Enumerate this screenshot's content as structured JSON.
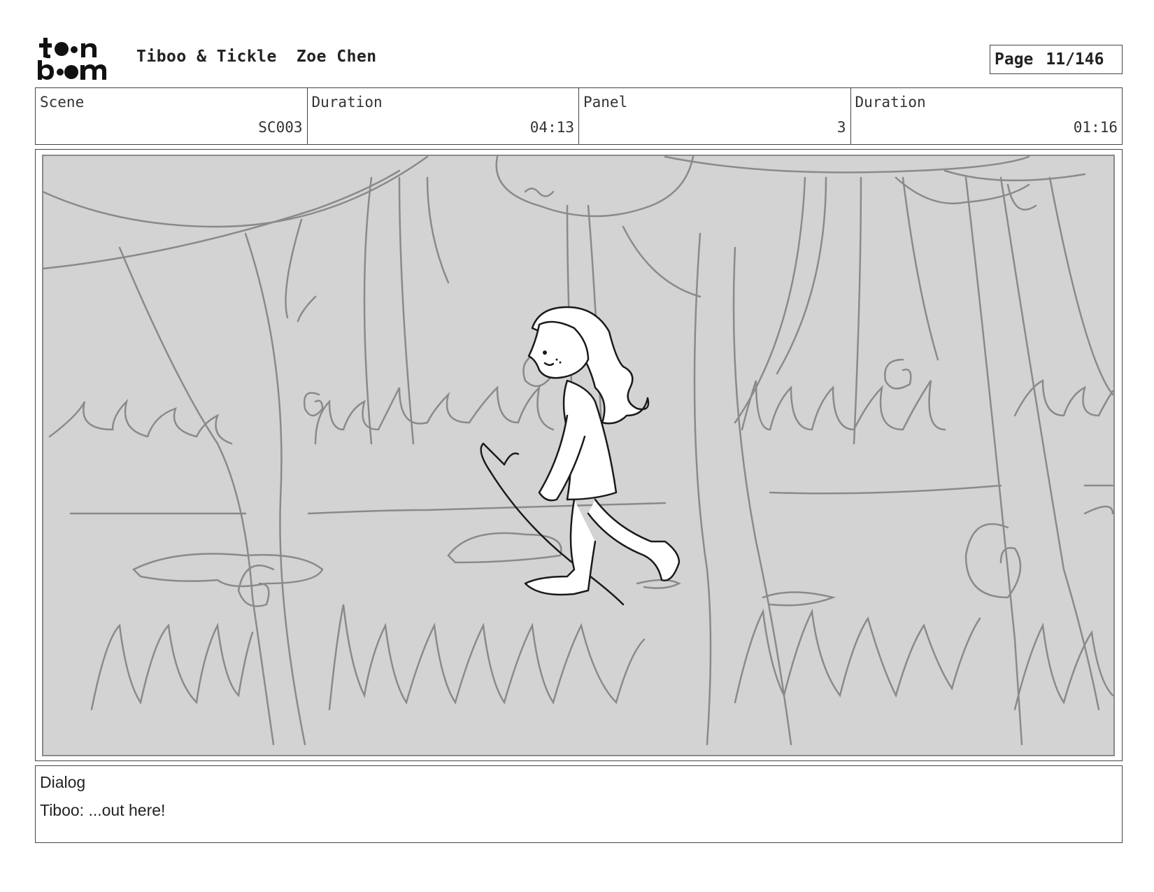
{
  "header": {
    "logo_text_top": "toon",
    "logo_text_bottom": "boom",
    "project_title": "Tiboo & Tickle",
    "artist": "Zoe Chen",
    "page_label": "Page",
    "page_number": "11/146"
  },
  "info": {
    "scene_label": "Scene",
    "scene_value": "SC003",
    "scene_duration_label": "Duration",
    "scene_duration_value": "04:13",
    "panel_label": "Panel",
    "panel_value": "3",
    "panel_duration_label": "Duration",
    "panel_duration_value": "01:16"
  },
  "dialog": {
    "label": "Dialog",
    "text": "Tiboo: ...out here!"
  },
  "colors": {
    "panel_fill": "#d3d3d3",
    "sketch_gray": "#8a8a8a",
    "ink": "#1a1a1a"
  }
}
